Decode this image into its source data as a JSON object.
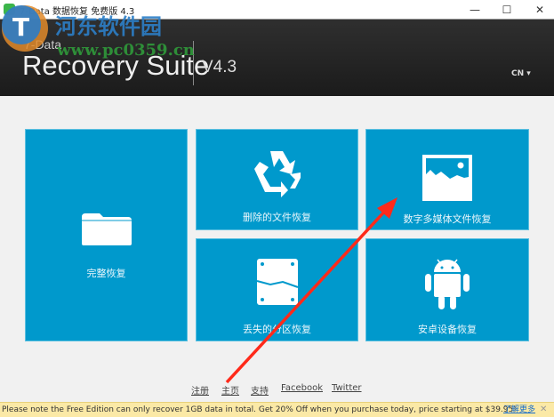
{
  "window": {
    "title": "7-Data 数据恢复 免费版 4.3",
    "minimize": "—",
    "maximize": "☐",
    "close": "✕"
  },
  "header": {
    "brand_small": "7-Data",
    "brand": "Recovery Suite",
    "version": "V4.3",
    "language": "CN ▾"
  },
  "tiles": [
    {
      "label": "完整恢复",
      "icon": "folder-icon"
    },
    {
      "label": "删除的文件恢复",
      "icon": "recycle-icon"
    },
    {
      "label": "数字多媒体文件恢复",
      "icon": "image-icon"
    },
    {
      "label": "丢失的分区恢复",
      "icon": "hard-drive-icon"
    },
    {
      "label": "安卓设备恢复",
      "icon": "android-icon"
    }
  ],
  "footer_links": [
    "注册",
    "主页",
    "支持",
    "Facebook",
    "Twitter"
  ],
  "banner": {
    "text": "Please note the Free Edition can only recover 1GB data in total. Get 20% Off when you purchase today, price starting at $39.95!",
    "more": "了解更多",
    "close": "✕"
  },
  "watermark": {
    "line1": "河东软件园",
    "line2": "www.pc0359.cn"
  },
  "colors": {
    "tile": "#0099cc",
    "header": "#222222",
    "arrow": "#ff2a1a"
  }
}
